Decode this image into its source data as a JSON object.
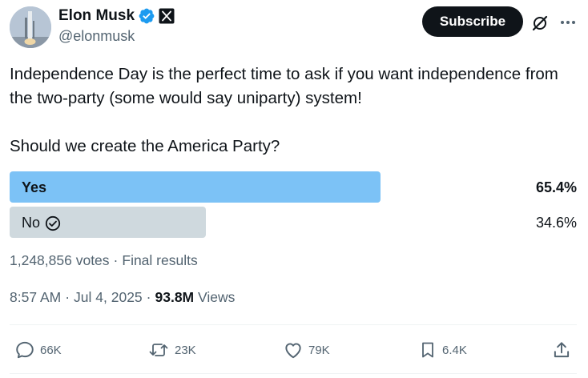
{
  "author": {
    "display_name": "Elon Musk",
    "handle": "@elonmusk",
    "verified": true,
    "affiliate_badge": "x-logo-icon"
  },
  "header": {
    "subscribe_label": "Subscribe",
    "grok_icon": "grok-icon",
    "more_icon": "more-icon"
  },
  "tweet": {
    "text_1": "Independence Day is the perfect time to ask if you want independence from the two-party (some would say uniparty) system!",
    "text_2": "Should we create the America Party?"
  },
  "poll": {
    "options": [
      {
        "label": "Yes",
        "percent_text": "65.4%",
        "percent": 65.4,
        "leading": true
      },
      {
        "label": "No",
        "percent_text": "34.6%",
        "percent": 34.6,
        "leading": false,
        "voted": true
      }
    ],
    "votes": "1,248,856 votes",
    "status": "Final results"
  },
  "meta": {
    "time": "8:57 AM",
    "date": "Jul 4, 2025",
    "views_count": "93.8M",
    "views_label": "Views"
  },
  "actions": {
    "replies": "66K",
    "reposts": "23K",
    "likes": "79K",
    "bookmarks": "6.4K"
  },
  "colors": {
    "leading_bar": "#7cc2f6",
    "other_bar": "#cfd9de",
    "verified_blue": "#1d9bf0",
    "secondary_text": "#536471"
  }
}
